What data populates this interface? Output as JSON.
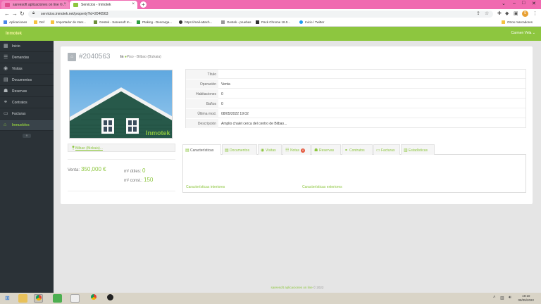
{
  "browser": {
    "tabs": [
      {
        "label": "sareesoft aplicaciones on line ©..."
      },
      {
        "label": "Servicios - Inmotek"
      }
    ],
    "url": "servicios.inmotek.net/property?id=2040563",
    "bookmarks": [
      "Aplicaciones",
      "Def",
      "Importador de Inter...",
      "Gestek - Sareesoft In...",
      "Ptaking - Descarga...",
      "https://mail-attach...",
      "Gestek - pruebas",
      "Pack Chrome 18.0...",
      "Inicio / Twitter"
    ],
    "other_bookmarks": "Otros marcadores"
  },
  "app": {
    "logo": "Inmotek",
    "user_menu": "Carmen Vela"
  },
  "sidebar": {
    "items": [
      {
        "label": "Inicio",
        "icon": "grid-icon"
      },
      {
        "label": "Demandas",
        "icon": "list-icon"
      },
      {
        "label": "Visitas",
        "icon": "eye-icon"
      },
      {
        "label": "Documentos",
        "icon": "file-icon"
      },
      {
        "label": "Reservas",
        "icon": "group-icon"
      },
      {
        "label": "Contratos",
        "icon": "handshake-icon"
      },
      {
        "label": "Facturas",
        "icon": "folder-icon"
      },
      {
        "label": "Inmuebles",
        "icon": "home-icon",
        "active": true
      }
    ],
    "collapse_label": "«"
  },
  "property": {
    "id": "#2040563",
    "in_label": "In",
    "location": "Piso - Bilbao (Bizkaia)",
    "photo_watermark": "Inmotek",
    "address": "Bilbao (Bizkaia)...",
    "price_label": "Venta:",
    "price": "350,000 €",
    "m2_utiles_label": "m² útiles:",
    "m2_utiles": "0",
    "m2_const_label": "m² const.:",
    "m2_const": "150",
    "info": [
      {
        "label": "Título",
        "value": ""
      },
      {
        "label": "Operación",
        "value": "Venta"
      },
      {
        "label": "Habitaciones",
        "value": "0"
      },
      {
        "label": "Baños",
        "value": "0"
      },
      {
        "label": "Última mod.",
        "value": "08/05/2022 19:02"
      },
      {
        "label": "Descripción",
        "value": "Amplio chalet cerca del centro de Bilbao..."
      }
    ],
    "tabs": [
      {
        "label": "Características",
        "icon": "list-icon",
        "active": true
      },
      {
        "label": "Documentos",
        "icon": "file-icon"
      },
      {
        "label": "Visitas",
        "icon": "eye-icon"
      },
      {
        "label": "Notas",
        "icon": "note-icon",
        "badge": "0"
      },
      {
        "label": "Reservas",
        "icon": "group-icon"
      },
      {
        "label": "Contratos",
        "icon": "handshake-icon"
      },
      {
        "label": "Facturas",
        "icon": "folder-icon"
      },
      {
        "label": "Estadísticas",
        "icon": "chart-icon"
      }
    ],
    "caract_interiores": "Características interiores",
    "caract_exteriores": "Características exteriores"
  },
  "footer": {
    "brand": "sareesoft aplicaciones on line",
    "year": "© 2022"
  },
  "taskbar": {
    "time": "19:10",
    "date": "08/05/2022"
  },
  "colors": {
    "accent": "#8dc63f",
    "sidebar": "#2b3237",
    "tabstrip": "#f06ab0"
  }
}
